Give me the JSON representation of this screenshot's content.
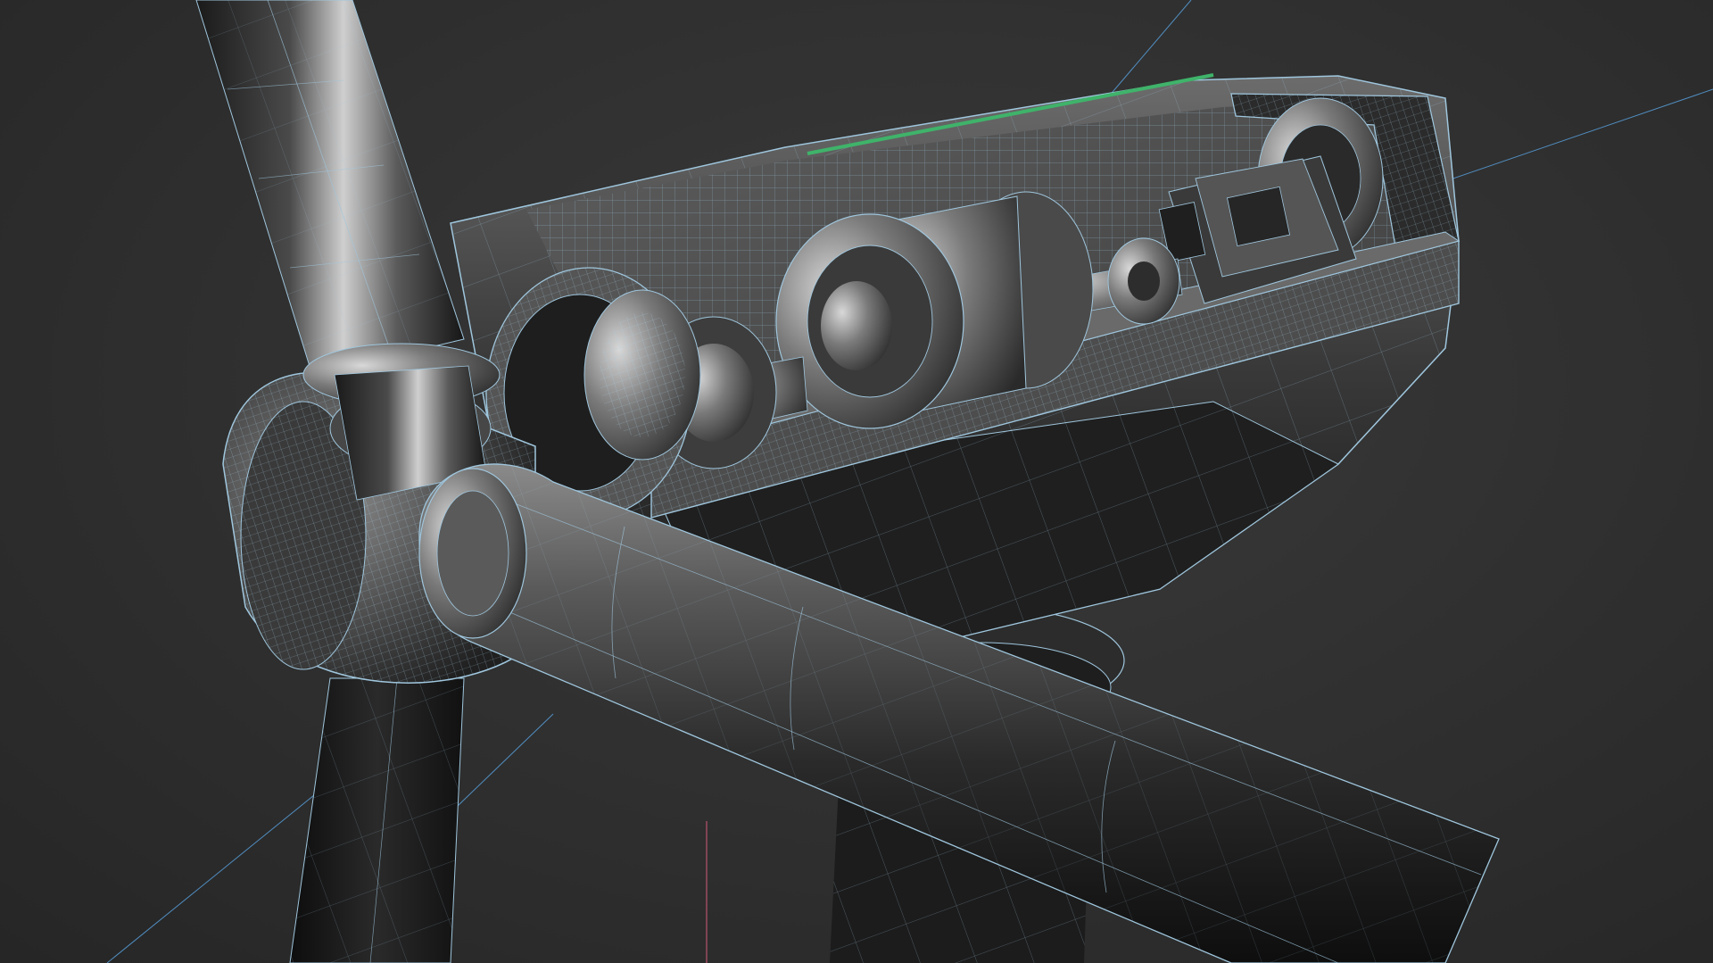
{
  "viewport": {
    "name": "3d-viewport",
    "display_mode": "shaded-wireframe",
    "background_color": "#2e2e2e",
    "wire_color": "#9fc6dd",
    "shading_dark": "#141414",
    "shading_mid": "#3d3d3d",
    "shading_light": "#9a9a9a",
    "highlight_edge_color": "#3fb36a",
    "construction_line_color": "#5aa6e6",
    "vertical_axis_color": "#d35a7a"
  },
  "scene": {
    "model": "wind-turbine-nacelle-cutaway",
    "components": [
      "rotor-blade-upper",
      "rotor-blade-lower",
      "rotor-blade-front",
      "hub-spinner",
      "nacelle-housing",
      "main-bearing",
      "gearbox",
      "generator",
      "coupling",
      "control-cabinet",
      "yaw-ring",
      "tower"
    ]
  }
}
